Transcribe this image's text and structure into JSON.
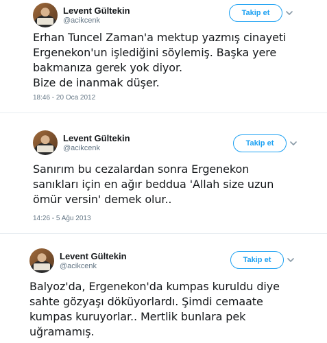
{
  "tweets": [
    {
      "name": "Levent Gültekin",
      "handle": "@acikcenk",
      "follow_label": "Takip et",
      "text": "Erhan Tuncel Zaman'a mektup yazmış cinayeti\nErgenekon'un işlediğini söylemiş. Başka yere\nbakmanıza gerek yok diyor.\nBize de inanmak düşer.",
      "timestamp": "18:46 - 20 Oca 2012"
    },
    {
      "name": "Levent Gültekin",
      "handle": "@acikcenk",
      "follow_label": "Takip et",
      "text": "Sanırım bu cezalardan sonra  Ergenekon\nsanıkları için en ağır beddua 'Allah size uzun\nömür versin' demek olur..",
      "timestamp": "14:26 - 5 Ağu 2013"
    },
    {
      "name": "Levent Gültekin",
      "handle": "@acikcenk",
      "follow_label": "Takip et",
      "text": "Balyoz'da, Ergenekon'da kumpas kuruldu diye\nsahte gözyaşı döküyorlardı. Şimdi cemaate\nkumpas kuruyorlar.. Mertlik bunlara pek\nuğramamış.",
      "timestamp": ""
    }
  ],
  "icons": {
    "avatar": "profile-photo",
    "menu": "chevron-down-icon"
  },
  "colors": {
    "accent": "#1da1f2",
    "text": "#14171a",
    "muted": "#657786"
  }
}
